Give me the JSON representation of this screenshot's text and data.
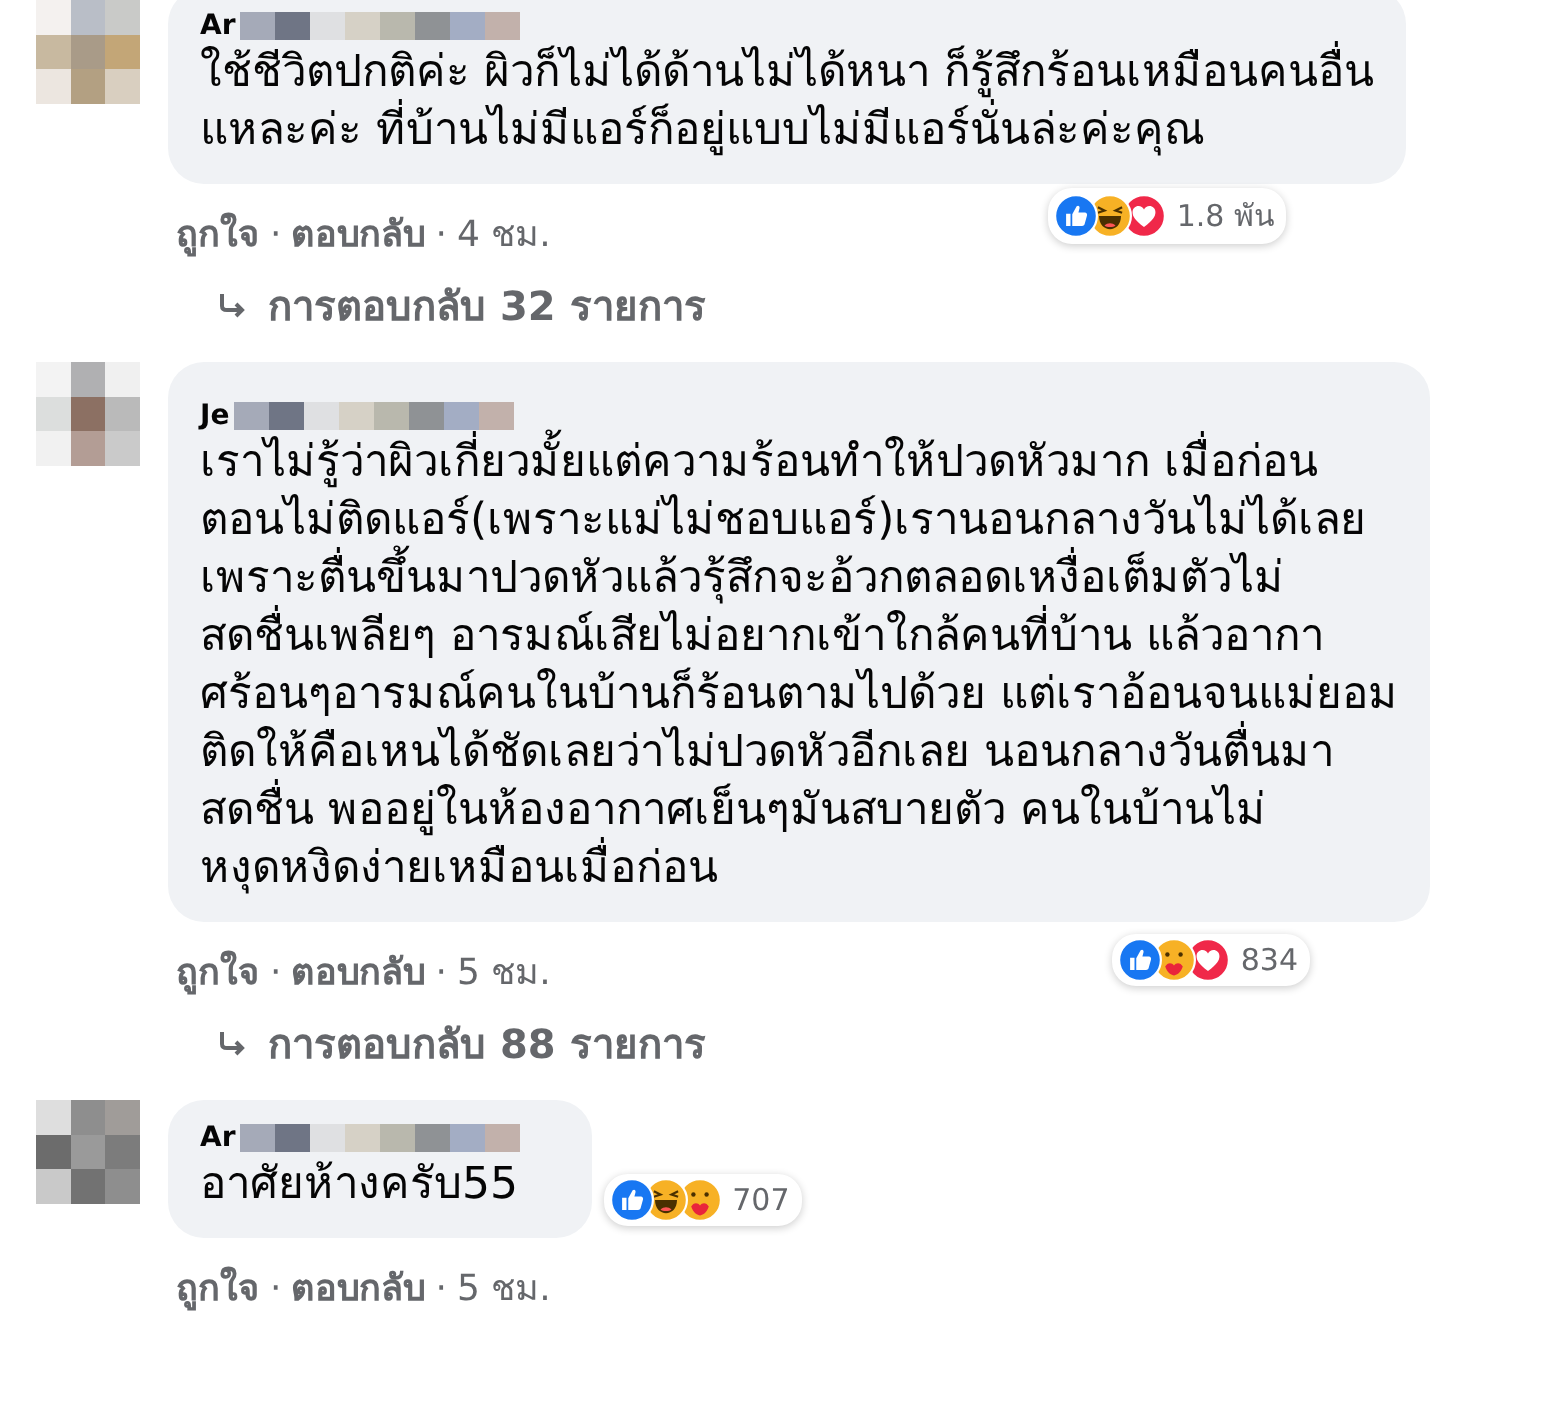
{
  "separator": "·",
  "comments": [
    {
      "name": "Ar",
      "text_lines": [
        "ใช้ชีวิตปกติค่ะ ผิวก็ไม่ได้ด้านไม่ได้หนา ก็รู้สึกร้อนเหมือนคนอื่น",
        "แหละค่ะ ที่บ้านไม่มีแอร์ก็อยู่แบบไม่มีแอร์นั่นล่ะค่ะคุณ"
      ],
      "reactions": [
        {
          "kind": "like"
        },
        {
          "kind": "haha"
        },
        {
          "kind": "love"
        }
      ],
      "reaction_count": "1.8 พัน",
      "actions": [
        "ถูกใจ",
        "ตอบกลับ",
        "4 ชม."
      ],
      "replies": "การตอบกลับ 32 รายการ"
    },
    {
      "name": "Je",
      "text_lines": [
        "เราไม่รู้ว่าผิวเกี่ยวมั้ยแต่ความร้อนทำให้ปวดหัวมาก เมื่อก่อน",
        "ตอนไม่ติดแอร์(เพราะแม่ไม่ชอบแอร์)เรานอนกลางวันไม่ได้เลย",
        "เพราะตื่นขึ้นมาปวดหัวแล้วรุ้สึกจะอ้วกตลอดเหงื่อเต็มตัวไม่",
        "สดชื่นเพลียๆ อารมณ์เสียไม่อยากเข้าใกล้คนที่บ้าน แล้วอากา",
        "ศร้อนๆอารมณ์คนในบ้านก็ร้อนตามไปด้วย แต่เราอ้อนจนแม่ยอม",
        "ติดให้คือเหนได้ชัดเลยว่าไม่ปวดหัวอีกเลย นอนกลางวันตื่นมา",
        "สดชื่น พออยู่ในห้องอากาศเย็นๆมันสบายตัว คนในบ้านไม่",
        "หงุดหงิดง่ายเหมือนเมื่อก่อน"
      ],
      "reactions": [
        {
          "kind": "like"
        },
        {
          "kind": "care"
        },
        {
          "kind": "love"
        }
      ],
      "reaction_count": "834",
      "actions": [
        "ถูกใจ",
        "ตอบกลับ",
        "5 ชม."
      ],
      "replies": "การตอบกลับ 88 รายการ"
    },
    {
      "name": "Ar",
      "text_lines": [
        "อาศัยห้างครับ55"
      ],
      "reactions": [
        {
          "kind": "like"
        },
        {
          "kind": "haha"
        },
        {
          "kind": "care"
        }
      ],
      "reaction_count": "707",
      "actions": [
        "ถูกใจ",
        "ตอบกลับ",
        "5 ชม."
      ]
    }
  ]
}
